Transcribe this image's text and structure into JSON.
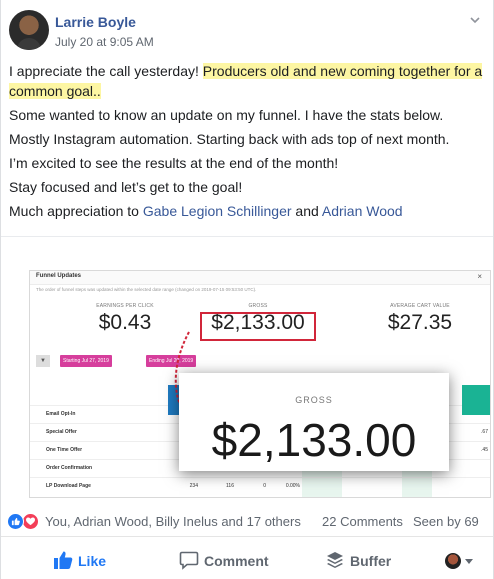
{
  "post": {
    "author": "Larrie Boyle",
    "timestamp": "July 20 at 9:05 AM",
    "text": {
      "line1_plain": "I appreciate the call yesterday! ",
      "line1_highlight": "Producers old and new coming together for a common goal..",
      "line2": "Some wanted to know an update on my funnel. I have the stats below.",
      "line3": "Mostly Instagram automation. Starting back with ads top of next month.",
      "line4": "I’m excited to see the results at the end of the month!",
      "line5": "Stay focused and let’s get to the goal!",
      "line6_prefix": "Much appreciation to ",
      "mention1": "Gabe Legion Schillinger",
      "line6_and": " and ",
      "mention2": "Adrian Wood"
    },
    "highlight_color": "#fdf6a3",
    "link_color": "#385898"
  },
  "screenshot": {
    "title": "Funnel Updates",
    "subtitle": "The order of funnel steps was updated within the selected date range (changed on 2019-07-15 09:53:50 UTC).",
    "close": "×",
    "stats": [
      {
        "label": "EARNINGS PER CLICK",
        "value": "$0.43"
      },
      {
        "label": "GROSS",
        "value": "$2,133.00"
      },
      {
        "label": "AVERAGE CART VALUE",
        "value": "$27.35"
      }
    ],
    "filter_icon": "filter-icon",
    "filters": [
      "Starting  Jul 27, 2019",
      "Ending  Jul 20, 2019"
    ],
    "rows": [
      {
        "label": "Email Opt-In",
        "cells": [
          "",
          "",
          "",
          ""
        ],
        "tail": ""
      },
      {
        "label": "Special Offer",
        "cells": [
          "",
          "",
          "",
          ""
        ],
        "tail": ".67"
      },
      {
        "label": "One Time Offer",
        "cells": [
          "",
          "",
          "",
          ""
        ],
        "tail": ".45"
      },
      {
        "label": "Order Confirmation",
        "cells": [
          "",
          "",
          "",
          ""
        ],
        "tail": ""
      },
      {
        "label": "LP Download Page",
        "cells": [
          "234",
          "116",
          "0",
          "0.00%"
        ],
        "tail": ""
      }
    ],
    "zoom": {
      "label": "GROSS",
      "value": "$2,133.00"
    },
    "accent_red": "#d1263a"
  },
  "reactions": {
    "names": "You, Adrian Wood, Billy Inelus and 17 others",
    "comments": "22 Comments",
    "seen": "Seen by 69"
  },
  "actions": {
    "like": "Like",
    "comment": "Comment",
    "buffer": "Buffer"
  }
}
